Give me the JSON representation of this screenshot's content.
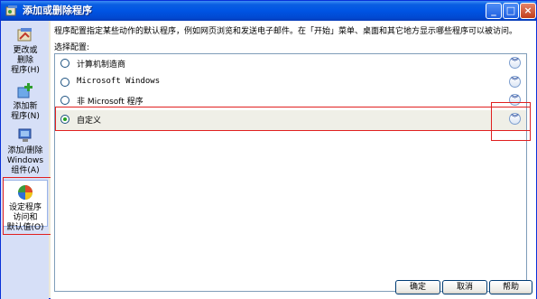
{
  "window": {
    "title": "添加或删除程序"
  },
  "title_buttons": {
    "minimize": "_",
    "maximize": "□",
    "close": "×"
  },
  "sidebar": {
    "items": [
      {
        "label": "更改或删除程序(H)",
        "lines": [
          "更改或",
          "删除",
          "程序(H)"
        ]
      },
      {
        "label": "添加新程序(N)",
        "lines": [
          "添加新",
          "程序(N)"
        ]
      },
      {
        "label": "添加/删除Windows组件(A)",
        "lines": [
          "添加/删除",
          "Windows",
          "组件(A)"
        ]
      },
      {
        "label": "设定程序访问和默认值(O)",
        "lines": [
          "设定程序",
          "访问和",
          "默认值(O)"
        ]
      }
    ],
    "selected_index": 3
  },
  "main": {
    "description": "程序配置指定某些动作的默认程序，例如网页浏览和发送电子邮件。在「开始」菜单、桌面和其它地方显示哪些程序可以被访问。",
    "choose_label": "选择配置:",
    "options": [
      {
        "label": "计算机制造商",
        "checked": false
      },
      {
        "label": "Microsoft Windows",
        "checked": false
      },
      {
        "label": "非 Microsoft 程序",
        "checked": false
      },
      {
        "label": "自定义",
        "checked": true
      }
    ]
  },
  "buttons": {
    "ok": "确定",
    "cancel": "取消",
    "help": "帮助"
  },
  "colors": {
    "titlebar": "#0054E3",
    "sidebar": "#D6DFF7",
    "highlight_box": "#E02020"
  }
}
